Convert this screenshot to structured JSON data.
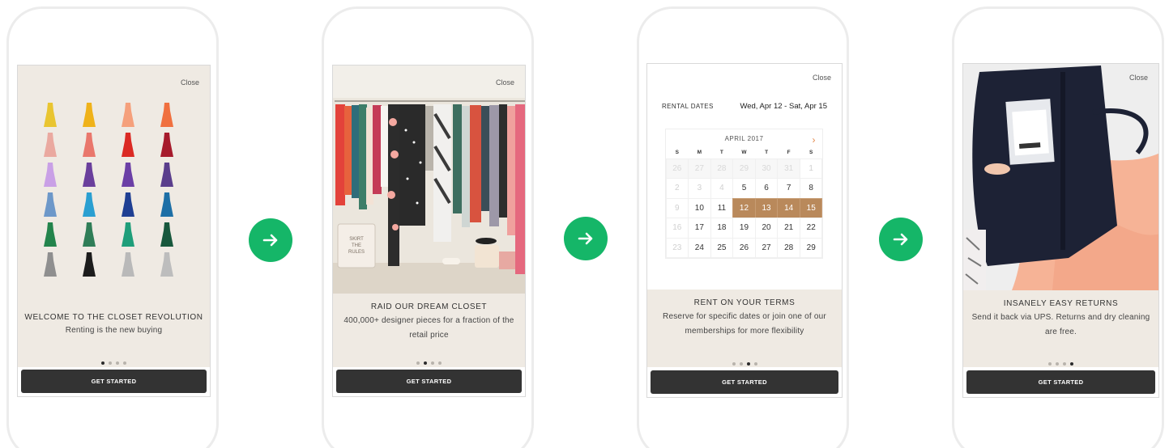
{
  "screens": [
    {
      "close_label": "Close",
      "title": "WELCOME TO THE CLOSET REVOLUTION",
      "subtitle": "Renting is the new buying",
      "cta_label": "GET STARTED",
      "active_dot": 0,
      "image": "dress-grid"
    },
    {
      "close_label": "Close",
      "title": "RAID OUR DREAM CLOSET",
      "subtitle": "400,000+ designer pieces for a fraction of the retail price",
      "cta_label": "GET STARTED",
      "active_dot": 1,
      "image": "closet-rack",
      "bag_text": "SKIRT THE RULES"
    },
    {
      "close_label": "Close",
      "title": "RENT ON YOUR TERMS",
      "subtitle": "Reserve for specific dates or join one of our memberships for more flexibility",
      "cta_label": "GET STARTED",
      "active_dot": 2,
      "rental_label": "RENTAL DATES",
      "rental_value": "Wed, Apr 12 - Sat, Apr 15",
      "calendar": {
        "month": "APRIL 2017",
        "days_of_week": [
          "S",
          "M",
          "T",
          "W",
          "T",
          "F",
          "S"
        ],
        "cells": [
          {
            "d": "26",
            "s": "dim"
          },
          {
            "d": "27",
            "s": "dim"
          },
          {
            "d": "28",
            "s": "dim"
          },
          {
            "d": "29",
            "s": "dim"
          },
          {
            "d": "30",
            "s": "dim"
          },
          {
            "d": "31",
            "s": "dim"
          },
          {
            "d": "1",
            "s": "blank"
          },
          {
            "d": "2",
            "s": "blank"
          },
          {
            "d": "3",
            "s": "blank"
          },
          {
            "d": "4",
            "s": "blank"
          },
          {
            "d": "5",
            "s": ""
          },
          {
            "d": "6",
            "s": ""
          },
          {
            "d": "7",
            "s": ""
          },
          {
            "d": "8",
            "s": ""
          },
          {
            "d": "9",
            "s": "blank"
          },
          {
            "d": "10",
            "s": ""
          },
          {
            "d": "11",
            "s": ""
          },
          {
            "d": "12",
            "s": "sel"
          },
          {
            "d": "13",
            "s": "sel"
          },
          {
            "d": "14",
            "s": "sel"
          },
          {
            "d": "15",
            "s": "sel"
          },
          {
            "d": "16",
            "s": "blank"
          },
          {
            "d": "17",
            "s": ""
          },
          {
            "d": "18",
            "s": ""
          },
          {
            "d": "19",
            "s": ""
          },
          {
            "d": "20",
            "s": ""
          },
          {
            "d": "21",
            "s": ""
          },
          {
            "d": "22",
            "s": ""
          },
          {
            "d": "23",
            "s": "blank"
          },
          {
            "d": "24",
            "s": ""
          },
          {
            "d": "25",
            "s": ""
          },
          {
            "d": "26",
            "s": ""
          },
          {
            "d": "27",
            "s": ""
          },
          {
            "d": "28",
            "s": ""
          },
          {
            "d": "29",
            "s": ""
          }
        ]
      }
    },
    {
      "close_label": "Close",
      "title": "INSANELY EASY RETURNS",
      "subtitle": "Send it back via UPS. Returns and dry cleaning are free.",
      "cta_label": "GET STARTED",
      "active_dot": 3,
      "image": "garment-bag"
    }
  ],
  "colors": {
    "accent_green": "#15b668",
    "selected_date": "#b9895b",
    "caption_bg": "#efeae3",
    "cta_bg": "#333333"
  },
  "arrow_icon": "arrow-right-icon"
}
